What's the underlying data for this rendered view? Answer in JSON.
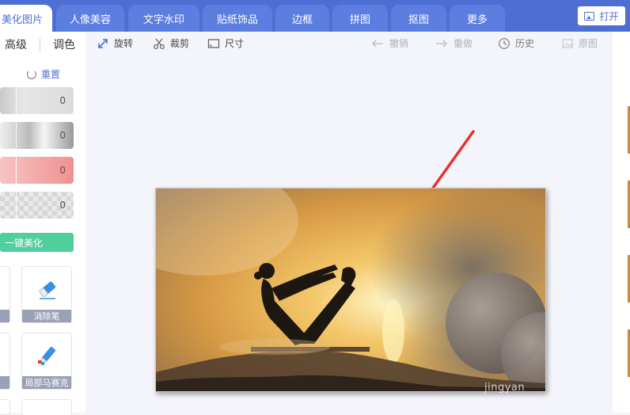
{
  "nav": {
    "tabs": [
      {
        "label": "美化图片",
        "active": true
      },
      {
        "label": "人像美容",
        "active": false
      },
      {
        "label": "文字水印",
        "active": false
      },
      {
        "label": "贴纸饰品",
        "active": false
      },
      {
        "label": "边框",
        "active": false
      },
      {
        "label": "拼图",
        "active": false
      },
      {
        "label": "抠图",
        "active": false
      },
      {
        "label": "更多",
        "active": false
      }
    ],
    "open_label": "打开",
    "open_icon": "image-open-icon"
  },
  "leftpanel": {
    "subtabs": [
      "高级",
      "调色"
    ],
    "reset_label": "重置",
    "sliders": [
      {
        "value": "0"
      },
      {
        "value": "0"
      },
      {
        "value": "0"
      },
      {
        "value": "0"
      }
    ],
    "onekey_label": "一键美化",
    "tools": [
      {
        "label": "消除笔",
        "icon": "eraser-icon"
      },
      {
        "label": "局部马赛克",
        "icon": "mosaic-pen-icon"
      }
    ]
  },
  "toolbar": {
    "rotate": "旋转",
    "crop": "裁剪",
    "size": "尺寸",
    "undo": "撤销",
    "redo": "重做",
    "history": "历史",
    "original": "原图"
  },
  "canvas": {
    "watermark": "jingyan",
    "arrow_color": "#e8322e"
  },
  "colors": {
    "nav_bg": "#4d6fd3",
    "accent": "#4d6fd3",
    "green": "#4fcf9b"
  }
}
